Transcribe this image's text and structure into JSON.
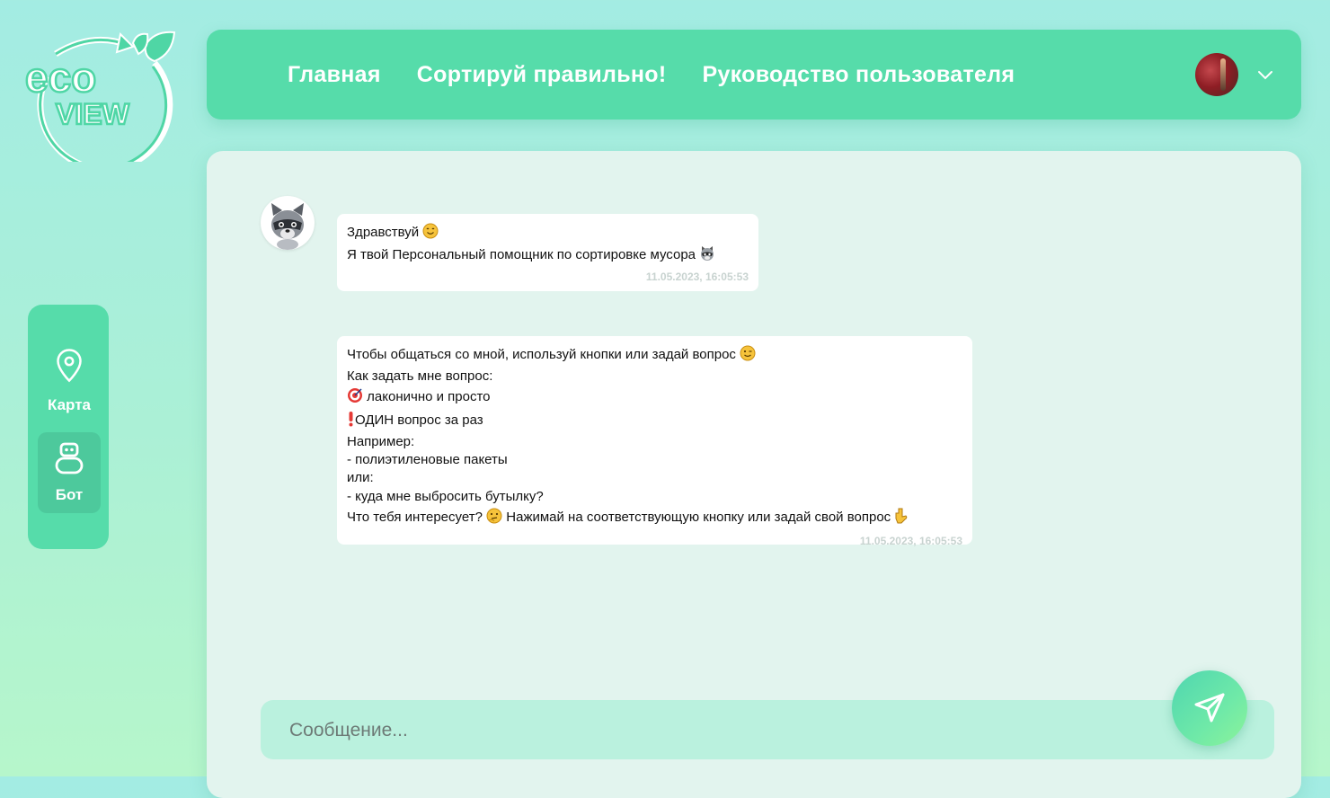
{
  "logo": {
    "line1": "eco",
    "line2": "VIEW"
  },
  "nav": {
    "links": [
      "Главная",
      "Сортируй правильно!",
      "Руководство пользователя"
    ]
  },
  "sidebar": {
    "items": [
      {
        "label": "Карта",
        "icon": "map-pin-icon"
      },
      {
        "label": "Бот",
        "icon": "robot-icon"
      }
    ]
  },
  "chat": {
    "messages": [
      {
        "lines": [
          "Здравствуй",
          "Я твой Персональный помощник по сортировке мусора"
        ],
        "timestamp": "11.05.2023, 16:05:53"
      },
      {
        "lines": [
          "Чтобы общаться со мной, используй кнопки или задай вопрос",
          "Как задать мне вопрос:",
          "лаконично и просто",
          "ОДИН вопрос за раз",
          "Например:",
          "- полиэтиленовые пакеты",
          "или:",
          "- куда мне выбросить бутылку?",
          "Что тебя интересует?",
          "Нажимай на соответствующую кнопку или задай свой вопрос"
        ],
        "timestamp": "11.05.2023, 16:05:53"
      }
    ],
    "input_placeholder": "Сообщение..."
  },
  "colors": {
    "accent": "#56dcaa",
    "panel": "#e2f4ee",
    "input": "#baf1de"
  }
}
